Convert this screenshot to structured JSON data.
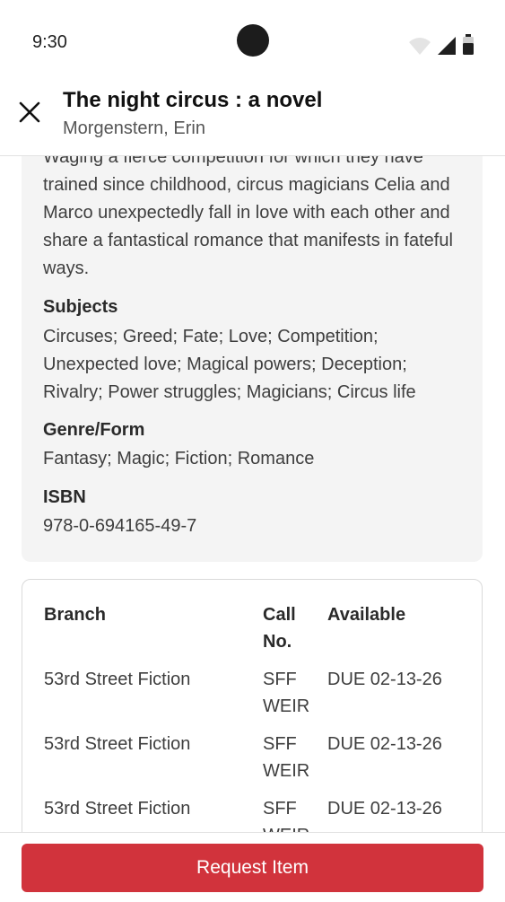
{
  "status_bar": {
    "time": "9:30"
  },
  "header": {
    "title": "The night circus : a novel",
    "author": "Morgenstern, Erin"
  },
  "details": {
    "summary": "Waging a fierce competition for which they have trained since childhood, circus magicians Celia and Marco unexpectedly fall in love with each other and share a fantastical romance that manifests in fateful ways.",
    "subjects_label": "Subjects",
    "subjects": " Circuses; Greed; Fate; Love; Competition; Unexpected love; Magical powers; Deception; Rivalry; Power struggles; Magicians; Circus life",
    "genre_label": "Genre/Form",
    "genre": " Fantasy; Magic; Fiction; Romance",
    "isbn_label": "ISBN",
    "isbn": "978-0-694165-49-7"
  },
  "holdings": {
    "headers": {
      "branch": "Branch",
      "call_no": "Call No.",
      "available": "Available"
    },
    "rows": [
      {
        "branch": "53rd Street Fiction",
        "call_no": "SFF WEIR",
        "available": "DUE 02-13-26"
      },
      {
        "branch": "53rd Street Fiction",
        "call_no": "SFF WEIR",
        "available": "DUE 02-13-26"
      },
      {
        "branch": "53rd Street Fiction",
        "call_no": "SFF WEIR",
        "available": "DUE 02-13-26"
      }
    ]
  },
  "actions": {
    "request_label": "Request Item"
  },
  "colors": {
    "accent": "#d1333c",
    "card_bg": "#f4f4f4"
  },
  "icons": {
    "close": "close-icon",
    "wifi": "wifi-icon",
    "signal": "signal-icon",
    "battery": "battery-icon"
  }
}
